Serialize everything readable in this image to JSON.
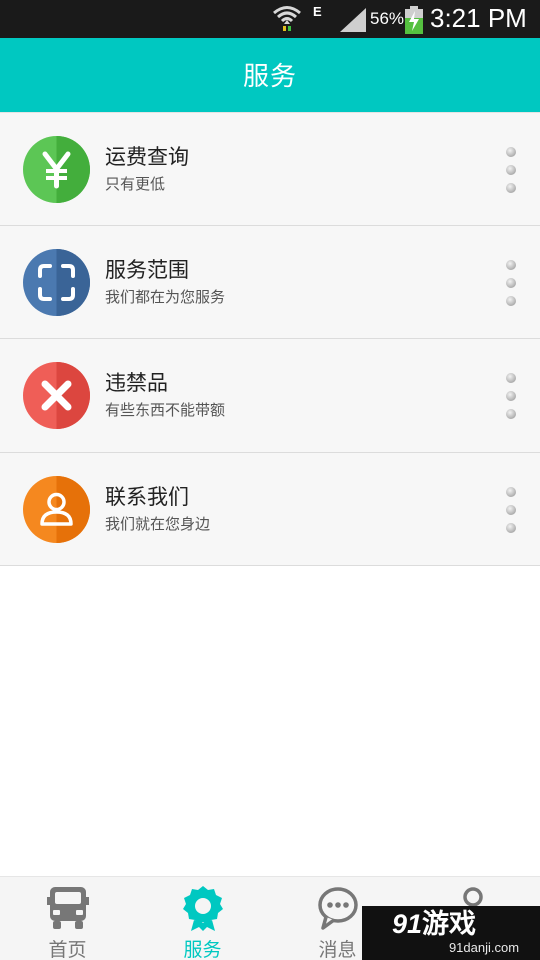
{
  "status_bar": {
    "network_type": "E",
    "battery_percent": "56%",
    "time": "3:21 PM",
    "icons": [
      "wifi-icon",
      "signal-icon",
      "battery-charging-icon"
    ]
  },
  "header": {
    "title": "服务",
    "background_color": "#00c8c1"
  },
  "services": [
    {
      "title": "运费查询",
      "subtitle": "只有更低",
      "icon": "yen-icon",
      "color": "#4cb848"
    },
    {
      "title": "服务范围",
      "subtitle": "我们都在为您服务",
      "icon": "scan-frame-icon",
      "color": "#3e6aa0"
    },
    {
      "title": "违禁品",
      "subtitle": "有些东西不能带额",
      "icon": "forbidden-x-icon",
      "color": "#e5504a"
    },
    {
      "title": "联系我们",
      "subtitle": "我们就在您身边",
      "icon": "contact-person-icon",
      "color": "#f07a10"
    }
  ],
  "bottom_nav": {
    "active_index": 1,
    "active_color": "#00c8c1",
    "items": [
      {
        "label": "首页",
        "icon": "truck-icon"
      },
      {
        "label": "服务",
        "icon": "badge-icon"
      },
      {
        "label": "消息",
        "icon": "chat-bubble-icon"
      },
      {
        "label": "",
        "icon": "user-icon"
      }
    ]
  },
  "watermark": {
    "brand": "游戏",
    "domain": "91danji.com"
  }
}
